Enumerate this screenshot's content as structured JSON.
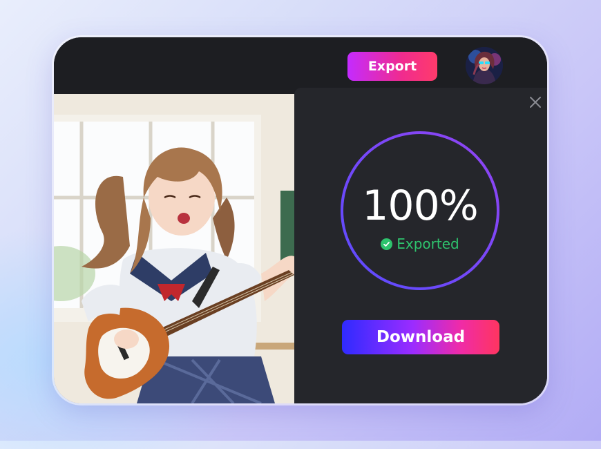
{
  "toolbar": {
    "export_label": "Export"
  },
  "export_panel": {
    "progress_text": "100%",
    "progress_value": 1.0,
    "status_text": "Exported",
    "download_label": "Download"
  },
  "colors": {
    "status_green": "#2ec36d",
    "ring_start": "#6a4bff",
    "ring_end": "#8b44f6",
    "panel_bg": "#25262b"
  },
  "icons": {
    "close": "close-icon",
    "check": "check-circle-icon",
    "avatar": "user-avatar"
  }
}
